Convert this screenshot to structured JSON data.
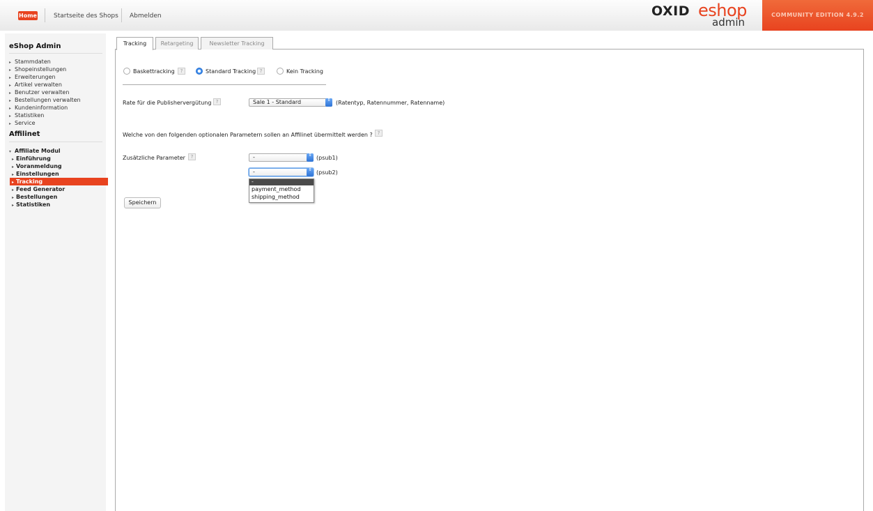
{
  "topbar": {
    "home": "Home",
    "shop_start": "Startseite des Shops",
    "logout": "Abmelden",
    "logo_oxid": "OXID",
    "logo_eshop": "eshop",
    "logo_admin": "admin",
    "edition": "COMMUNITY EDITION 4.9.2"
  },
  "sidebar": {
    "title": "eShop Admin",
    "items": [
      "Stammdaten",
      "Shopeinstellungen",
      "Erweiterungen",
      "Artikel verwalten",
      "Benutzer verwalten",
      "Bestellungen verwalten",
      "Kundeninformation",
      "Statistiken",
      "Service"
    ],
    "section": "Affilinet",
    "module": "Affiliate Modul",
    "sub_items": [
      "Einführung",
      "Voranmeldung",
      "Einstellungen",
      "Tracking",
      "Feed Generator",
      "Bestellungen",
      "Statistiken"
    ],
    "active_sub": "Tracking"
  },
  "tabs": [
    {
      "label": "Tracking",
      "active": true
    },
    {
      "label": "Retargeting",
      "active": false
    },
    {
      "label": "Newsletter Tracking",
      "active": false
    }
  ],
  "tracking_mode": {
    "options": [
      "Baskettracking",
      "Standard Tracking",
      "Kein Tracking"
    ],
    "selected": "Standard Tracking"
  },
  "rate": {
    "label": "Rate für die Publishervergütung",
    "value": "Sale 1 - Standard",
    "hint": "(Ratentyp, Ratennummer, Ratenname)"
  },
  "params_question": "Welche von den folgenden optionalen Parametern sollen an Affilinet übermittelt werden ?",
  "extra_params": {
    "label": "Zusätzliche Parameter",
    "psub1": {
      "value": "-",
      "suffix": "(psub1)"
    },
    "psub2": {
      "value": "-",
      "suffix": "(psub2)"
    },
    "dropdown_options": [
      "-",
      "payment_method",
      "shipping_method"
    ]
  },
  "save_button": "Speichern",
  "help_glyph": "?",
  "select_arrow_glyph": "⇕"
}
